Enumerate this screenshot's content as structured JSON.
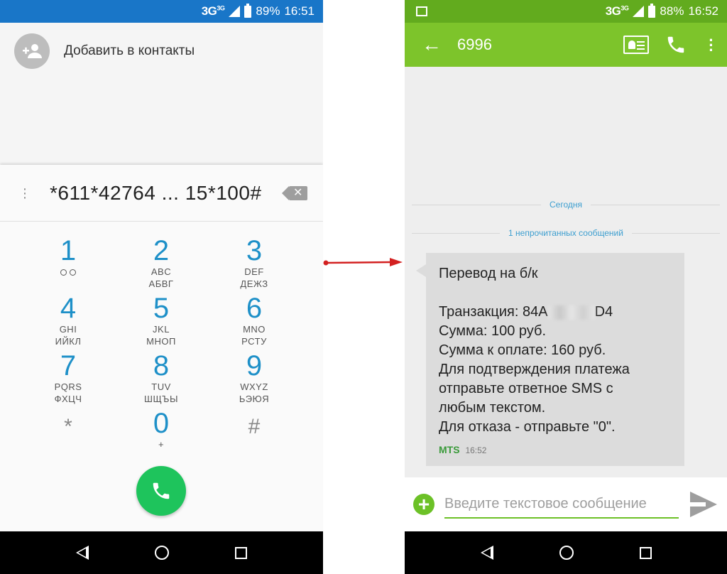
{
  "left_screen": {
    "status": {
      "network": "3G",
      "network_sup": "3G",
      "battery": "89%",
      "time": "16:51"
    },
    "add_contact_label": "Добавить в контакты",
    "dialed_number": "*611*42764 ... 15*100#",
    "keys": [
      {
        "digit": "1",
        "letters": "",
        "letters2": ""
      },
      {
        "digit": "2",
        "letters": "ABC",
        "letters2": "АБВГ"
      },
      {
        "digit": "3",
        "letters": "DEF",
        "letters2": "ДЕЖЗ"
      },
      {
        "digit": "4",
        "letters": "GHI",
        "letters2": "ИЙКЛ"
      },
      {
        "digit": "5",
        "letters": "JKL",
        "letters2": "МНОП"
      },
      {
        "digit": "6",
        "letters": "MNO",
        "letters2": "РСТУ"
      },
      {
        "digit": "7",
        "letters": "PQRS",
        "letters2": "ФХЦЧ"
      },
      {
        "digit": "8",
        "letters": "TUV",
        "letters2": "ШЩЪЫ"
      },
      {
        "digit": "9",
        "letters": "WXYZ",
        "letters2": "ЬЭЮЯ"
      },
      {
        "digit": "*",
        "letters": "",
        "letters2": ""
      },
      {
        "digit": "0",
        "letters": "+",
        "letters2": ""
      },
      {
        "digit": "#",
        "letters": "",
        "letters2": ""
      }
    ]
  },
  "right_screen": {
    "status": {
      "network": "3G",
      "network_sup": "3G",
      "battery": "88%",
      "time": "16:52"
    },
    "contact": "6996",
    "separator_today": "Сегодня",
    "separator_unread": "1 непрочитанных сообщений",
    "message": {
      "lines": [
        "Перевод на б/к",
        "",
        "Транзакция: 84A",
        "Сумма: 100 руб.",
        "Сумма к оплате: 160 руб.",
        "Для подтверждения платежа",
        "отправьте ответное SMS с",
        "любым текстом.",
        "Для отказа - отправьте \"0\"."
      ],
      "transaction_suffix": "D4",
      "sender": "MTS",
      "time": "16:52"
    },
    "composer_placeholder": "Введите текстовое сообщение"
  },
  "colors": {
    "dialer_status": "#1976c8",
    "sms_status": "#62ab1e",
    "sms_toolbar": "#7dc42b",
    "call_button": "#1ec45c",
    "digit_blue": "#1e90c8",
    "arrow_red": "#d32020"
  }
}
